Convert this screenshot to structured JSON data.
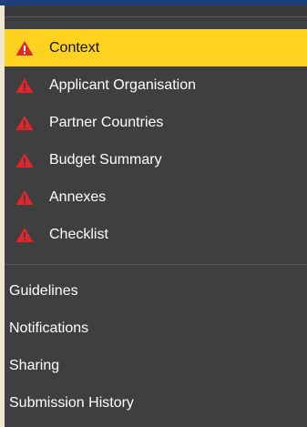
{
  "colors": {
    "background": "#3f3f3f",
    "active_background": "#ffd21f",
    "warning": "#e0262b",
    "text": "#ffffff",
    "active_text": "#111111"
  },
  "menu": {
    "primary": [
      {
        "label": "Context",
        "icon": "warning-icon",
        "active": true
      },
      {
        "label": "Applicant Organisation",
        "icon": "warning-icon",
        "active": false
      },
      {
        "label": "Partner Countries",
        "icon": "warning-icon",
        "active": false
      },
      {
        "label": "Budget Summary",
        "icon": "warning-icon",
        "active": false
      },
      {
        "label": "Annexes",
        "icon": "warning-icon",
        "active": false
      },
      {
        "label": "Checklist",
        "icon": "warning-icon",
        "active": false
      }
    ],
    "secondary": [
      {
        "label": "Guidelines"
      },
      {
        "label": "Notifications"
      },
      {
        "label": "Sharing"
      },
      {
        "label": "Submission History"
      }
    ]
  }
}
